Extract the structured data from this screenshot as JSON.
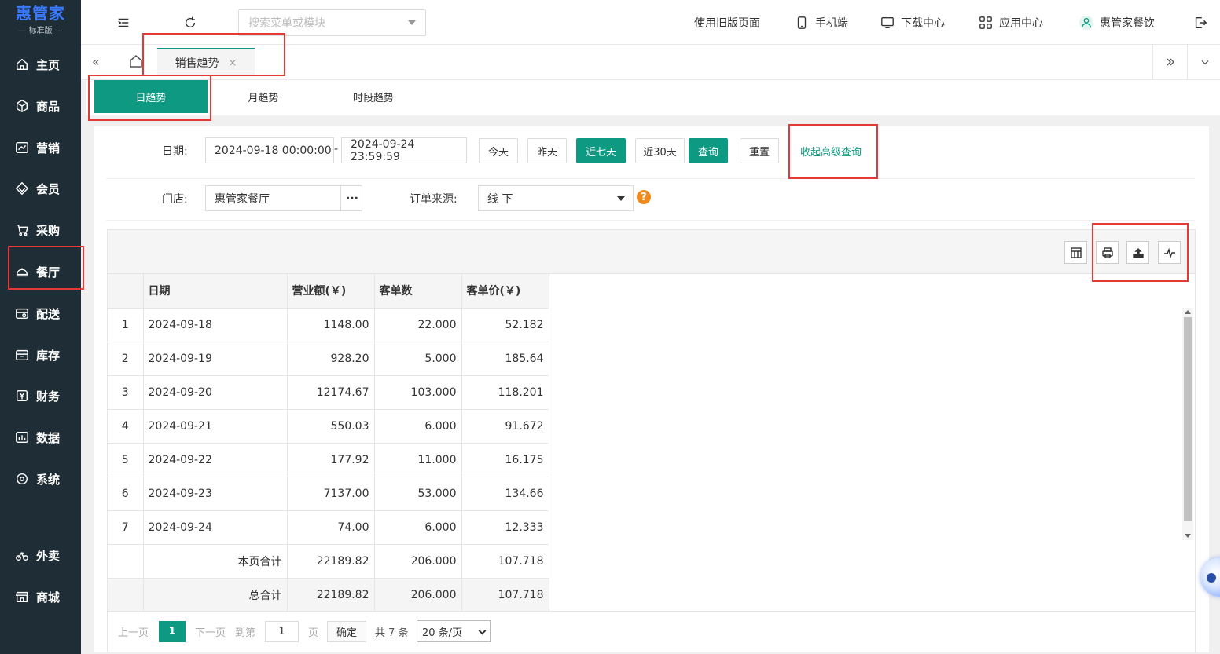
{
  "app": {
    "brand": "惠管家",
    "edition": "— 标准版 —"
  },
  "sidebar": {
    "items": [
      {
        "label": "主页",
        "icon": "home-icon"
      },
      {
        "label": "商品",
        "icon": "cube-icon"
      },
      {
        "label": "营销",
        "icon": "chart-icon"
      },
      {
        "label": "会员",
        "icon": "diamond-icon"
      },
      {
        "label": "采购",
        "icon": "cart-icon"
      },
      {
        "label": "餐厅",
        "icon": "cloche-icon"
      },
      {
        "label": "配送",
        "icon": "delivery-icon"
      },
      {
        "label": "库存",
        "icon": "inventory-icon"
      },
      {
        "label": "财务",
        "icon": "finance-icon"
      },
      {
        "label": "数据",
        "icon": "data-icon"
      },
      {
        "label": "系统",
        "icon": "settings-icon"
      },
      {
        "label": "外卖",
        "icon": "bike-icon"
      },
      {
        "label": "商城",
        "icon": "store-icon"
      }
    ]
  },
  "header": {
    "search_placeholder": "搜索菜单或模块",
    "old_page": "使用旧版页面",
    "mobile": "手机端",
    "download": "下载中心",
    "apps": "应用中心",
    "user": "惠管家餐饮"
  },
  "tabs": {
    "active_tab": "销售趋势",
    "close": "×"
  },
  "subtabs": {
    "items": [
      "日趋势",
      "月趋势",
      "时段趋势"
    ]
  },
  "filters": {
    "date_label": "日期:",
    "date_start": "2024-09-18 00:00:00",
    "date_sep": "-",
    "date_end": "2024-09-24 23:59:59",
    "btn_today": "今天",
    "btn_yesterday": "昨天",
    "btn_7days": "近七天",
    "btn_30days": "近30天",
    "btn_query": "查询",
    "btn_reset": "重置",
    "collapse_advanced": "收起高级查询",
    "store_label": "门店:",
    "store_value": "惠管家餐厅",
    "store_more": "···",
    "source_label": "订单来源:",
    "source_value": "线 下",
    "help": "?"
  },
  "table": {
    "columns": [
      "日期",
      "营业额(￥)",
      "客单数",
      "客单价(￥)"
    ],
    "rows": [
      {
        "idx": "1",
        "date": "2024-09-18",
        "revenue": "1148.00",
        "orders": "22.000",
        "avg": "52.182"
      },
      {
        "idx": "2",
        "date": "2024-09-19",
        "revenue": "928.20",
        "orders": "5.000",
        "avg": "185.64"
      },
      {
        "idx": "3",
        "date": "2024-09-20",
        "revenue": "12174.67",
        "orders": "103.000",
        "avg": "118.201"
      },
      {
        "idx": "4",
        "date": "2024-09-21",
        "revenue": "550.03",
        "orders": "6.000",
        "avg": "91.672"
      },
      {
        "idx": "5",
        "date": "2024-09-22",
        "revenue": "177.92",
        "orders": "11.000",
        "avg": "16.175"
      },
      {
        "idx": "6",
        "date": "2024-09-23",
        "revenue": "7137.00",
        "orders": "53.000",
        "avg": "134.66"
      },
      {
        "idx": "7",
        "date": "2024-09-24",
        "revenue": "74.00",
        "orders": "6.000",
        "avg": "12.333"
      }
    ],
    "page_total": {
      "label": "本页合计",
      "revenue": "22189.82",
      "orders": "206.000",
      "avg": "107.718"
    },
    "grand_total": {
      "label": "总合计",
      "revenue": "22189.82",
      "orders": "206.000",
      "avg": "107.718"
    }
  },
  "pager": {
    "prev": "上一页",
    "current": "1",
    "next": "下一页",
    "goto": "到第",
    "goto_value": "1",
    "page_unit": "页",
    "confirm": "确定",
    "total": "共 7 条",
    "page_size": "20 条/页"
  },
  "colors": {
    "accent": "#0e9a82",
    "sidebar_bg": "#1f2d36",
    "highlight": "#e53935"
  }
}
